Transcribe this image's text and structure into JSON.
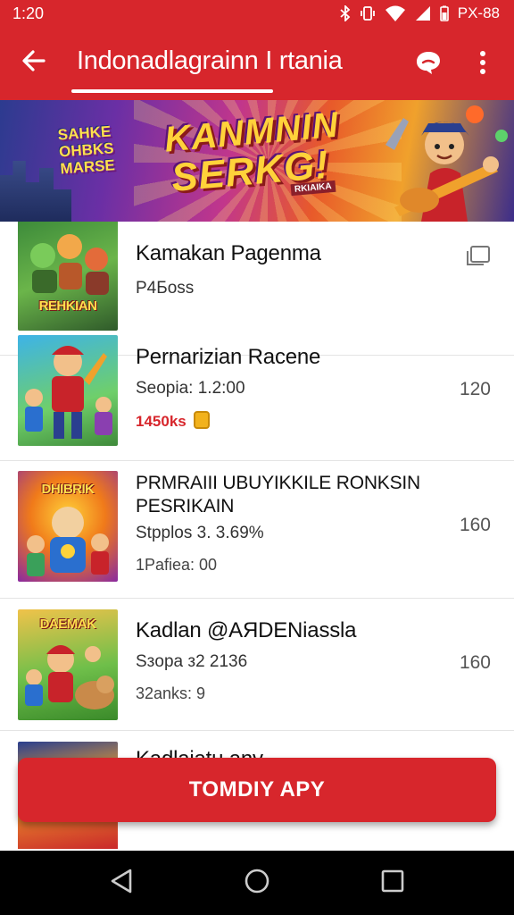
{
  "status_bar": {
    "time": "1:20",
    "right_text": "PX-88",
    "icons": [
      "bluetooth-icon",
      "vibrate-icon",
      "wifi-icon",
      "signal-icon",
      "battery-icon"
    ]
  },
  "app_bar": {
    "title": "Indonadlagrainn I rtania",
    "icons": [
      "back-arrow-icon",
      "chat-icon",
      "more-vert-icon"
    ],
    "color": "#d7262c"
  },
  "banner": {
    "small_text": "SAHKE OHBKS MARSE",
    "big_line1": "KANMNIN",
    "big_line2": "SERKG!",
    "tagline": "RKIAIKA"
  },
  "list": {
    "items": [
      {
        "thumb_title": "REHKIAN",
        "title": "Kamakan Pagenma",
        "subtitle": "P4Боss",
        "right_icon": "copy-icon"
      },
      {
        "thumb_title": "",
        "title": "Pernarizian Racene",
        "subtitle": "Seopia: 1.2:00",
        "meta": "1450ks",
        "meta_icon": "coin-icon",
        "right_value": "120"
      },
      {
        "thumb_title": "DHIBRIK",
        "title": "PRMRAIII UBUYIKKILE RONKSIN PESRIKAIN",
        "subtitle": "Stpplos 3. 3.69%",
        "meta": "1Pafiea: 00",
        "right_value": "160"
      },
      {
        "thumb_title": "DAEMAK",
        "title": "Kadlan @AЯDENiassla",
        "subtitle": "Sзopa з2 2136",
        "meta": "32anks: 9",
        "right_value": "160"
      },
      {
        "thumb_title": "",
        "title": "Kadlaiatu anv",
        "subtitle": ""
      }
    ]
  },
  "cta": {
    "label": "TOMDIY APY"
  },
  "nav_bar": {
    "icons": [
      "back-triangle-icon",
      "home-circle-icon",
      "recents-square-icon"
    ]
  }
}
